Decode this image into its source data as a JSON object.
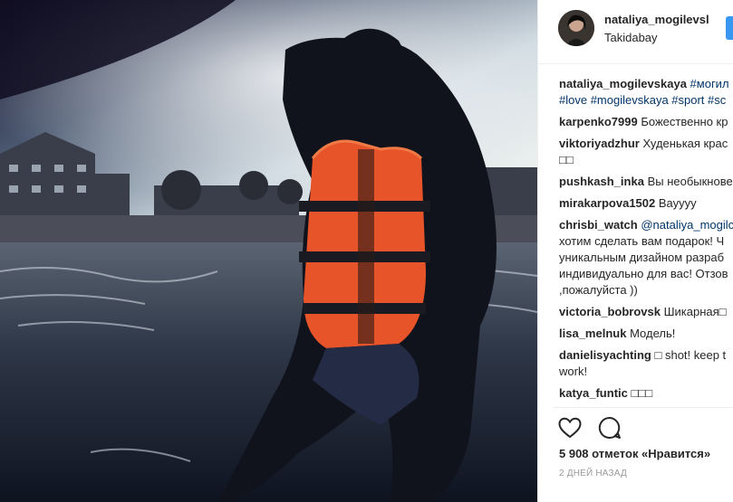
{
  "post": {
    "owner": "nataliya_mogilevsl",
    "location": "Takidabay",
    "caption_user": "nataliya_mogilevskaya",
    "caption_tags_line1": "#могил",
    "caption_tags_line2": "#love #mogilevskaya #sport #sc",
    "likes": "5 908 отметок «Нравится»",
    "date": "2 ДНЕЙ НАЗАД"
  },
  "comments": [
    {
      "user": "karpenko7999",
      "text": "Божественно кр"
    },
    {
      "user": "viktoriyadzhur",
      "text": "Худенькая крас",
      "text2": "□□"
    },
    {
      "user": "pushkash_inka",
      "text": "Вы необыкнове"
    },
    {
      "user": "mirakarpova1502",
      "text": "Вауууу"
    },
    {
      "user": "chrisbi_watch",
      "mention": "@nataliya_mogilc",
      "lines": [
        "хотим сделать вам подарок! Ч",
        "уникальным дизайном разраб",
        "индивидуально для вас! Отзов",
        ",пожалуйста ))"
      ]
    },
    {
      "user": "victoria_bobrovsk",
      "text": "Шикарная□"
    },
    {
      "user": "lisa_melnuk",
      "text": "Модель!"
    },
    {
      "user": "danielisyachting",
      "text": "□ shot! keep t",
      "text2": "work!"
    },
    {
      "user": "katya_funtic",
      "text": "□□□"
    }
  ],
  "icons": [
    "heart-icon",
    "comment-icon"
  ],
  "colors": {
    "accent": "#3897f0",
    "link": "#003569",
    "text": "#262626"
  }
}
